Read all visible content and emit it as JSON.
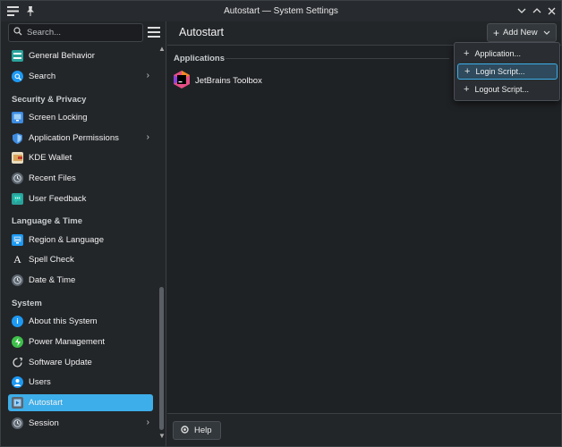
{
  "window": {
    "title": "Autostart — System Settings",
    "menu_icon": "≡",
    "pin_icon": "📌",
    "controls": [
      "⌄",
      "⌃",
      "✕"
    ]
  },
  "sidebar": {
    "search_placeholder": "Search...",
    "sections": [
      {
        "key": "top",
        "heading": ""
      },
      {
        "key": "security",
        "heading": "Security & Privacy"
      },
      {
        "key": "language",
        "heading": "Language & Time"
      },
      {
        "key": "system",
        "heading": "System"
      }
    ],
    "items": [
      {
        "label": "General Behavior",
        "icon": "general-behavior-icon",
        "color": "#2aa29a",
        "chevron": false,
        "selected": false
      },
      {
        "label": "Search",
        "icon": "search-settings-icon",
        "color": "#1d99f3",
        "chevron": true,
        "selected": false
      },
      {
        "label": "Screen Locking",
        "icon": "screen-lock-icon",
        "color": "#3d8be0",
        "chevron": false,
        "selected": false
      },
      {
        "label": "Application Permissions",
        "icon": "shield-icon",
        "color": "#3d8be0",
        "chevron": true,
        "selected": false
      },
      {
        "label": "KDE Wallet",
        "icon": "wallet-icon",
        "color": "#d9c9a0",
        "chevron": false,
        "selected": false
      },
      {
        "label": "Recent Files",
        "icon": "clock-icon",
        "color": "#5c6670",
        "chevron": false,
        "selected": false
      },
      {
        "label": "User Feedback",
        "icon": "feedback-icon",
        "color": "#2aa29a",
        "chevron": false,
        "selected": false
      },
      {
        "label": "Region & Language",
        "icon": "region-icon",
        "color": "#1d99f3",
        "chevron": false,
        "selected": false
      },
      {
        "label": "Spell Check",
        "icon": "spell-check-icon",
        "color": "#232629",
        "chevron": false,
        "selected": false
      },
      {
        "label": "Date & Time",
        "icon": "date-time-icon",
        "color": "#5c6670",
        "chevron": false,
        "selected": false
      },
      {
        "label": "About this System",
        "icon": "info-icon",
        "color": "#1d99f3",
        "chevron": false,
        "selected": false
      },
      {
        "label": "Power Management",
        "icon": "power-icon",
        "color": "#3ec04a",
        "chevron": false,
        "selected": false
      },
      {
        "label": "Software Update",
        "icon": "update-icon",
        "color": "#232629",
        "chevron": false,
        "selected": false
      },
      {
        "label": "Users",
        "icon": "users-icon",
        "color": "#1d99f3",
        "chevron": false,
        "selected": false
      },
      {
        "label": "Autostart",
        "icon": "autostart-icon",
        "color": "#5c6670",
        "chevron": false,
        "selected": true
      },
      {
        "label": "Session",
        "icon": "session-icon",
        "color": "#5c6670",
        "chevron": true,
        "selected": false
      }
    ]
  },
  "main": {
    "title": "Autostart",
    "add_new_label": "Add New",
    "applications_heading": "Applications",
    "apps": [
      {
        "label": "JetBrains Toolbox",
        "icon": "jetbrains-toolbox-icon"
      }
    ],
    "help_label": "Help"
  },
  "dropdown": {
    "items": [
      {
        "label": "Application...",
        "active": false
      },
      {
        "label": "Login Script...",
        "active": true
      },
      {
        "label": "Logout Script...",
        "active": false
      }
    ]
  },
  "colors": {
    "accent": "#3daee9",
    "window_bg": "#202326",
    "sidebar_bg": "#232629"
  }
}
